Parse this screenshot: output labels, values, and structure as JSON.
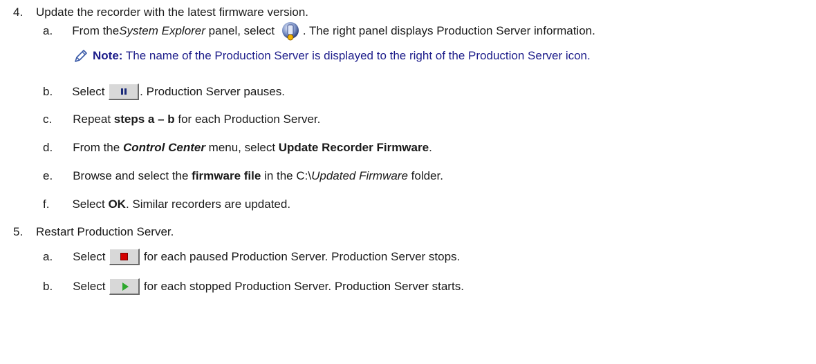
{
  "step4": {
    "num": "4.",
    "text": "Update the recorder with the latest firmware version."
  },
  "step4a": {
    "letter": "a.",
    "t1": "From the ",
    "t2_italic": "System Explorer",
    "t3": " panel, select ",
    "t4": ". The right panel displays Production Server information."
  },
  "note": {
    "label": "Note:",
    "text": " The name of the Production Server is displayed to the right of the Production Server icon."
  },
  "step4b": {
    "letter": "b.",
    "t1": "Select ",
    "t2": ". Production Server pauses."
  },
  "step4c": {
    "letter": "c.",
    "t1": "Repeat ",
    "t2_bold": "steps a – b",
    "t3": " for each Production Server."
  },
  "step4d": {
    "letter": "d.",
    "t1": "From the ",
    "t2_bolditalic": "Control Center",
    "t3": " menu, select ",
    "t4_bold": "Update Recorder Firmware",
    "t5": "."
  },
  "step4e": {
    "letter": "e.",
    "t1": "Browse and select the ",
    "t2_bold": "firmware file",
    "t3": " in the C:\\",
    "t4_italic": "Updated Firmware",
    "t5": " folder."
  },
  "step4f": {
    "letter": "f.",
    "t1": "Select ",
    "t2_bold": "OK",
    "t3": ". Similar recorders are updated."
  },
  "step5": {
    "num": "5.",
    "text": "Restart Production Server."
  },
  "step5a": {
    "letter": "a.",
    "t1": "Select ",
    "t2": " for each paused Production Server. Production Server stops."
  },
  "step5b": {
    "letter": "b.",
    "t1": "Select ",
    "t2": " for each stopped Production Server. Production Server starts."
  },
  "icons": {
    "server": "production-server-icon",
    "pause": "pause-button-icon",
    "stop": "stop-button-icon",
    "start": "start-button-icon",
    "note": "pencil-note-icon"
  },
  "colors": {
    "note_text": "#1c1c8a",
    "stop": "#d40000",
    "start": "#2ca82c"
  }
}
